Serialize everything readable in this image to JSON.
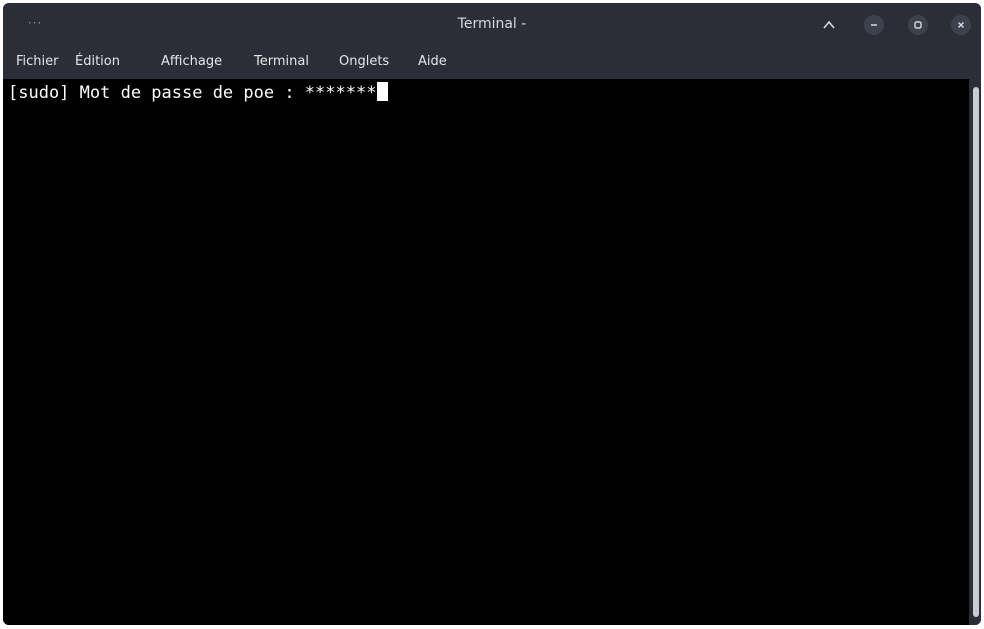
{
  "window": {
    "title": "Terminal -",
    "menu_dots": "···",
    "controls": {
      "collapse_icon": "chevron-up-icon",
      "minimize_icon": "minimize-icon",
      "maximize_icon": "maximize-icon",
      "close_icon": "close-icon"
    }
  },
  "menubar": {
    "items": [
      {
        "label": "Fichier"
      },
      {
        "label": "Édition"
      },
      {
        "label": "Affichage"
      },
      {
        "label": "Terminal"
      },
      {
        "label": "Onglets"
      },
      {
        "label": "Aide"
      }
    ]
  },
  "terminal": {
    "lines": [
      "[sudo] Mot de passe de poe : *******"
    ],
    "background_color": "#000000",
    "text_color": "#ffffff"
  },
  "colors": {
    "chrome": "#2b2e36",
    "button_bg": "#3d414b",
    "title_text": "#d5d8de"
  }
}
